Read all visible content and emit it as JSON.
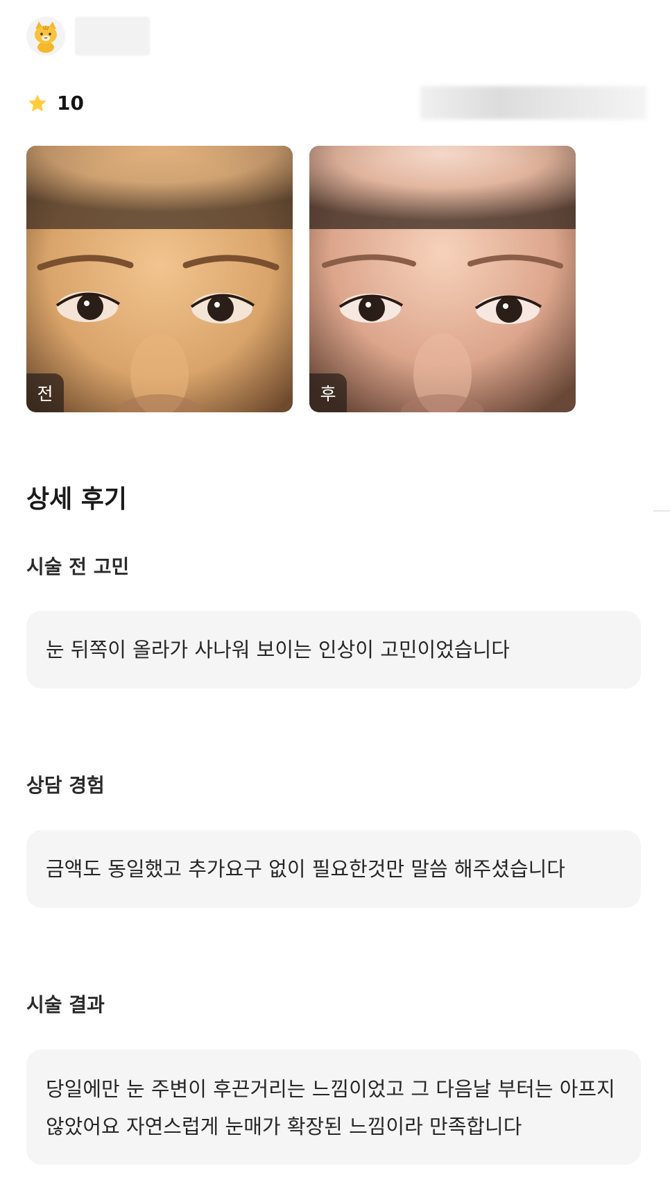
{
  "review": {
    "rating": "10",
    "photo_tags": {
      "before": "전",
      "after": "후"
    },
    "section_title": "상세 후기",
    "questions": [
      {
        "label": "시술 전 고민",
        "answer": "눈 뒤쪽이 올라가 사나워 보이는 인상이 고민이었습니다"
      },
      {
        "label": "상담 경험",
        "answer": "금액도 동일했고 추가요구 없이 필요한것만 말씀 해주셨습니다"
      },
      {
        "label": "시술 결과",
        "answer_lines": [
          "당일에만 눈 주변이 후끈거리는 느낌이었고 그 다음날 부터는 아프지",
          "않았어요 자연스럽게 눈매가 확장된 느낌이라 만족합니다"
        ]
      }
    ]
  },
  "colors": {
    "star": "#ffcd3c",
    "card_bg": "#f5f5f5",
    "tag_bg": "#281e19"
  },
  "icons": {
    "avatar": "cat-avatar-icon",
    "star": "star-icon"
  }
}
